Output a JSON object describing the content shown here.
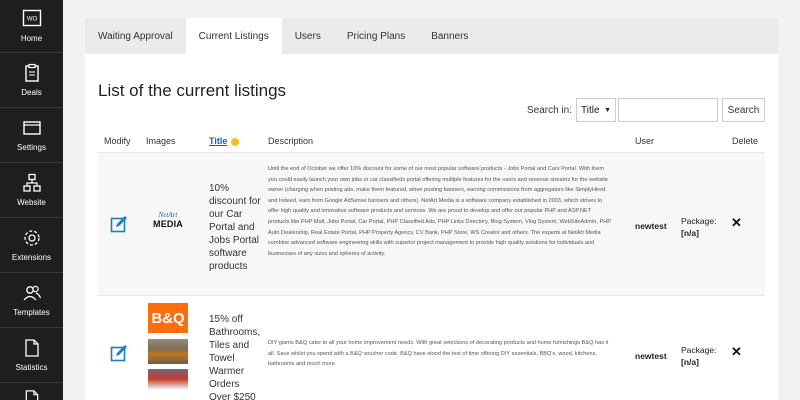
{
  "sidebar": {
    "items": [
      {
        "label": "Home",
        "icon": "home-icon"
      },
      {
        "label": "Deals",
        "icon": "clipboard-icon"
      },
      {
        "label": "Settings",
        "icon": "window-icon"
      },
      {
        "label": "Website",
        "icon": "sitemap-icon"
      },
      {
        "label": "Extensions",
        "icon": "gear-icon"
      },
      {
        "label": "Templates",
        "icon": "users-icon"
      },
      {
        "label": "Statistics",
        "icon": "document-icon"
      }
    ]
  },
  "tabs": [
    {
      "label": "Waiting Approval",
      "active": false
    },
    {
      "label": "Current Listings",
      "active": true
    },
    {
      "label": "Users",
      "active": false
    },
    {
      "label": "Pricing Plans",
      "active": false
    },
    {
      "label": "Banners",
      "active": false
    }
  ],
  "page": {
    "title": "List of the current listings"
  },
  "search": {
    "label": "Search in:",
    "field": "Title",
    "value": "",
    "button": "Search"
  },
  "columns": {
    "modify": "Modify",
    "images": "Images",
    "title": "Title",
    "description": "Description",
    "user": "User",
    "delete": "Delete"
  },
  "rows": [
    {
      "logo_line1": "NetArt",
      "logo_line2": "MEDIA",
      "title": "10% discount for our Car Portal and Jobs Portal software products",
      "description": "Until the end of October we offer 10% discount for some of our most popular software products - Jobs Portal and Cars Portal. With them you could easily launch your own jobs or car classifieds portal offering multiple features for the users and revenue streams for the website owner (charging when posting ads, make them featured, when posting banners, earning commissions from aggregators like SimplyHired and Indeed, earn from Google AdSense banners and others). NetArt Media is a software company established in 2003, which strives to offer high quality and innovative software products and services. We are proud to develop and offer our popular PHP and ASP.NET products like PHP Mall, Jobs Portal, Car Portal, PHP Classified Ads, PHP Links Directory, Blog System, Vlog System, WebSiteAdmin, PHP Auto Dealership, Real Estate Portal, PHP Property Agency, CV Bank, PHP Store, WS Creator and others. The experts at NetArt Media combine advanced software engineering skills with superior project management to provide high quality solutions for individuals and businesses of any sizes and spheres of activity.",
      "user": "newtest",
      "package_label": "Package:",
      "package_value": "[n/a]"
    },
    {
      "logo_text": "B&Q",
      "title": "15% off Bathrooms, Tiles and Towel Warmer Orders Over $250",
      "description": "DIY giants B&Q cater to all your home improvement needs. With great selections of decorating products and home furnishings B&Q has it all. Save whilst you spend with a B&Q voucher code. B&Q have stood the test of time offering DIY essentials, BBQ's, wood, kitchens, bathrooms and much more.",
      "user": "newtest",
      "package_label": "Package:",
      "package_value": "[n/a]"
    }
  ],
  "colors": {
    "sidebar_bg": "#1e1e1e",
    "accent_link": "#1a5fa8",
    "bq_orange": "#ff6d0c",
    "edit_icon": "#1a7fc1"
  }
}
